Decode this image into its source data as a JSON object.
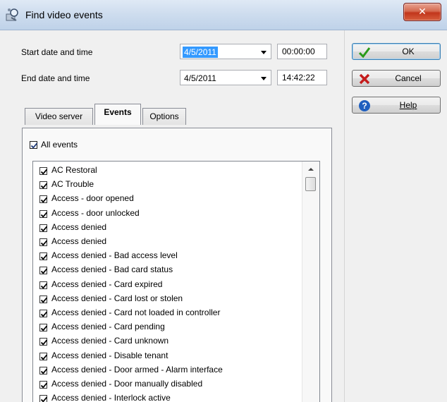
{
  "window": {
    "title": "Find video events",
    "close_glyph": "✕"
  },
  "form": {
    "start_label": "Start date and time",
    "start_date": "4/5/2011",
    "start_time": "00:00:00",
    "end_label": "End date and time",
    "end_date": "4/5/2011",
    "end_time": "14:42:22"
  },
  "buttons": {
    "ok": "OK",
    "cancel": "Cancel",
    "help": "Help"
  },
  "tabs": [
    "Video server",
    "Events",
    "Options"
  ],
  "events_panel": {
    "all_events_label": "All events",
    "all_events_checked": true,
    "items": [
      "AC Restoral",
      "AC Trouble",
      "Access - door opened",
      "Access - door unlocked",
      "Access denied",
      "Access denied",
      "Access denied - Bad access level",
      "Access denied - Bad card status",
      "Access denied - Card expired",
      "Access denied - Card lost or stolen",
      "Access denied - Card not loaded in controller",
      "Access denied - Card pending",
      "Access denied - Card unknown",
      "Access denied - Disable tenant",
      "Access denied - Door armed - Alarm interface",
      "Access denied - Door manually disabled",
      "Access denied - Interlock active"
    ]
  },
  "colors": {
    "selection": "#3399ff",
    "ok_icon": "#2a9a1a",
    "cancel_icon": "#c41b1b",
    "help_icon": "#1f5fbf"
  },
  "icons": {
    "title": "find-events-icon",
    "ok": "checkmark-icon",
    "cancel": "x-icon",
    "help": "help-icon"
  }
}
